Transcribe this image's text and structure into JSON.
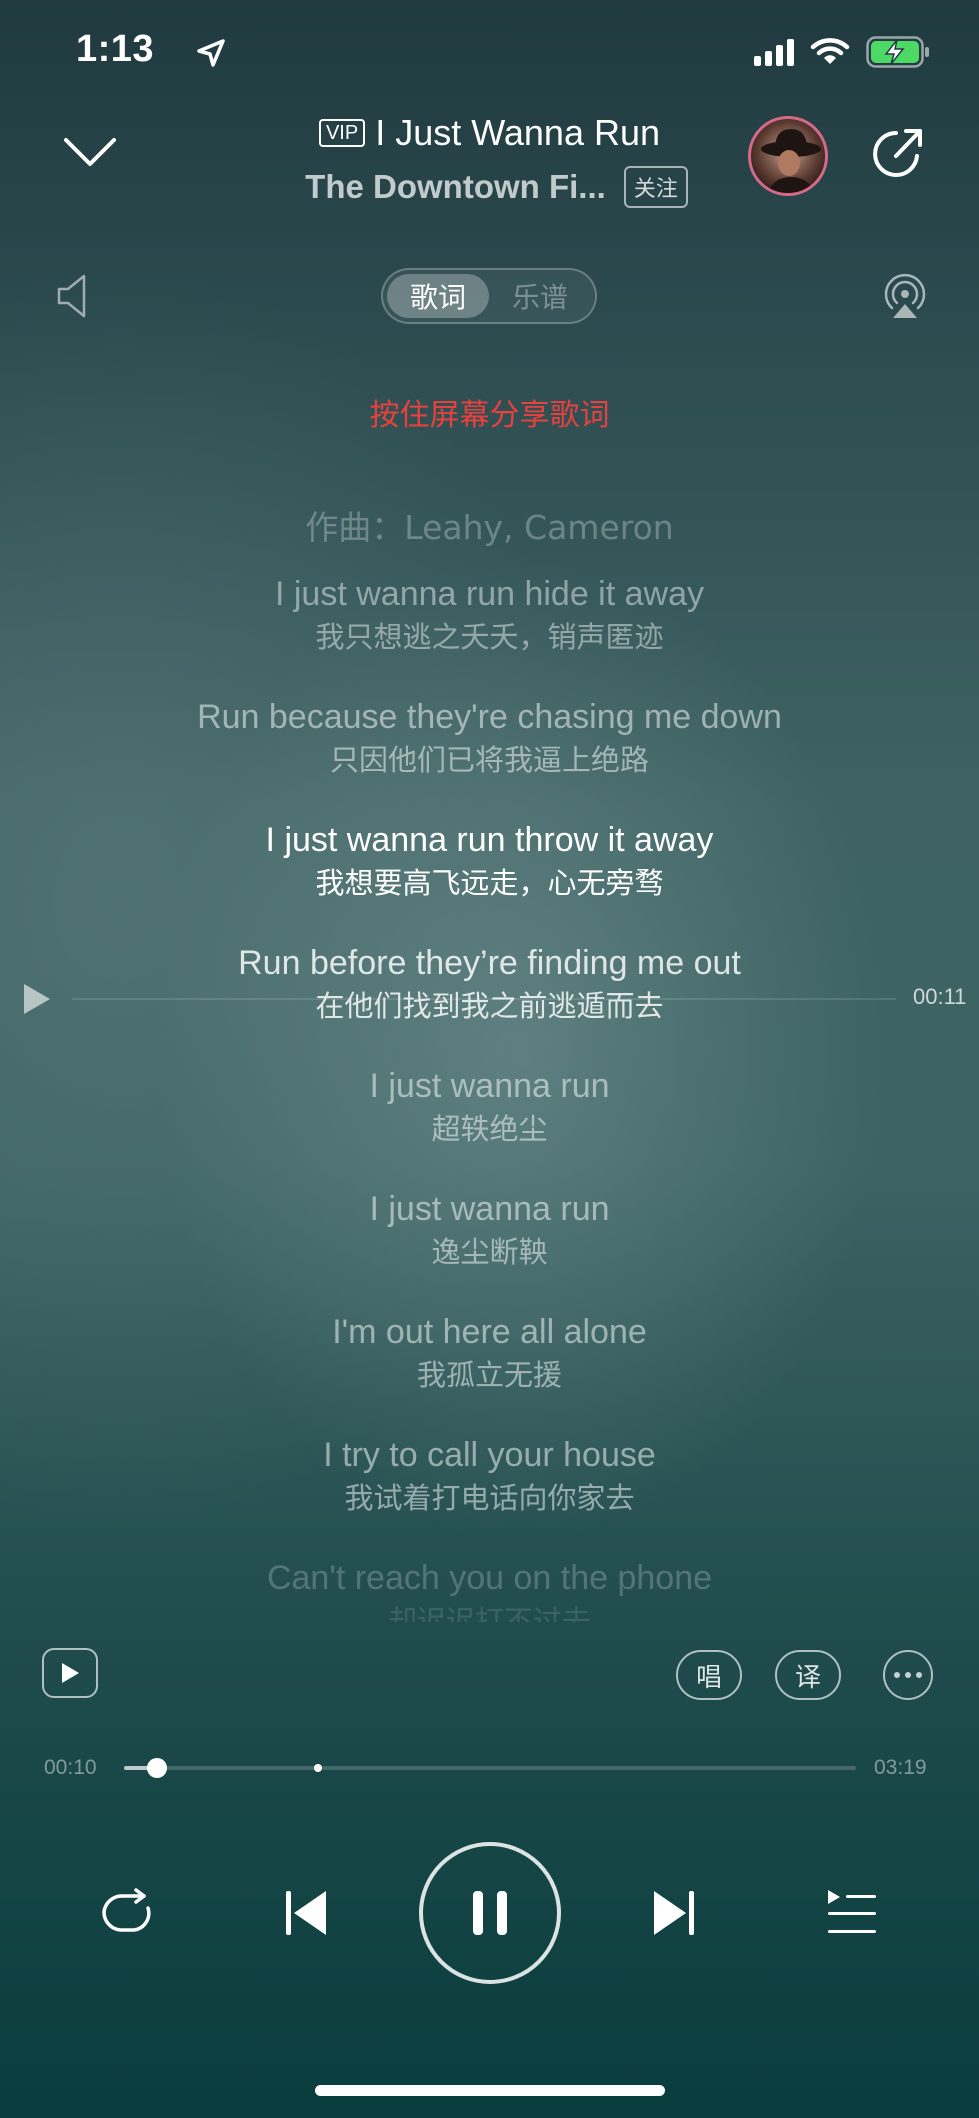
{
  "status_bar": {
    "time": "1:13",
    "icons": [
      "location-arrow-icon",
      "signal-icon",
      "wifi-icon",
      "battery-charging-icon"
    ],
    "battery_color": "#4cd964"
  },
  "header": {
    "vip_badge": "VIP",
    "song_title": "I Just Wanna Run",
    "artist": "The Downtown Fi...",
    "follow_label": "关注"
  },
  "tabs": [
    {
      "label": "歌词",
      "active": true
    },
    {
      "label": "乐谱",
      "active": false
    }
  ],
  "share_hint": "按住屏幕分享歌词",
  "share_hint_color": "#e8403c",
  "lyrics": {
    "composer": "作曲：Leahy, Cameron",
    "lines": [
      {
        "en": "I just wanna run hide it away",
        "zh": "我只想逃之夭夭，销声匿迹"
      },
      {
        "en": "Run because they're chasing me down",
        "zh": "只因他们已将我逼上绝路"
      },
      {
        "en": "I just wanna run throw it away",
        "zh": "我想要高飞远走，心无旁骛"
      },
      {
        "en": "Run before they’re finding me out",
        "zh": "在他们找到我之前逃遁而去"
      },
      {
        "en": "I just wanna run",
        "zh": "超轶绝尘"
      },
      {
        "en": "I just wanna run",
        "zh": "逸尘断鞅"
      },
      {
        "en": "I'm out here all alone",
        "zh": "我孤立无援"
      },
      {
        "en": "I try to call your house",
        "zh": "我试着打电话向你家去"
      },
      {
        "en": "Can't reach you on the phone",
        "zh": "却迟迟打不过去"
      }
    ]
  },
  "seek_time": "00:11",
  "tools": {
    "sing_label": "唱",
    "translate_label": "译"
  },
  "progress": {
    "current": "00:10",
    "total": "03:19",
    "fraction": 0.045
  }
}
